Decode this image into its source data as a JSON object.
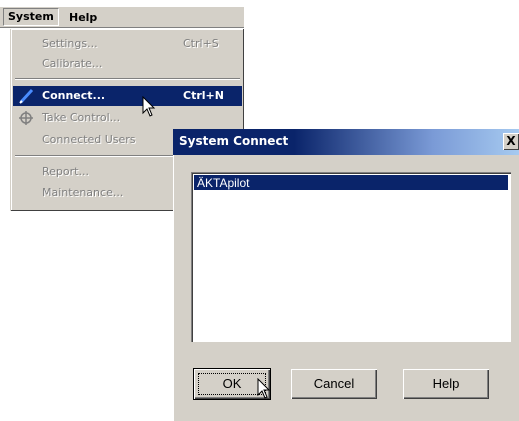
{
  "menubar": {
    "items": [
      {
        "label": "System",
        "active": true
      },
      {
        "label": "Help",
        "active": false
      }
    ]
  },
  "menu": {
    "items": [
      {
        "label": "Settings...",
        "shortcut": "Ctrl+S",
        "state": "disabled",
        "icon": ""
      },
      {
        "label": "Calibrate...",
        "shortcut": "",
        "state": "disabled",
        "icon": ""
      },
      {
        "label": "Connect...",
        "shortcut": "Ctrl+N",
        "state": "highlighted",
        "icon": "connect-pen-icon"
      },
      {
        "label": "Take Control...",
        "shortcut": "",
        "state": "disabled",
        "icon": "take-control-icon"
      },
      {
        "label": "Connected Users",
        "shortcut": "",
        "state": "disabled",
        "icon": ""
      },
      {
        "label": "Report...",
        "shortcut": "",
        "state": "disabled",
        "icon": ""
      },
      {
        "label": "Maintenance...",
        "shortcut": "",
        "state": "disabled",
        "icon": ""
      }
    ]
  },
  "dialog": {
    "title": "System Connect",
    "close_label": "X",
    "list_items": [
      {
        "label": "ÄKTApilot",
        "selected": true
      }
    ],
    "buttons": {
      "ok": "OK",
      "cancel": "Cancel",
      "help": "Help"
    }
  },
  "colors": {
    "selection": "#0a246a",
    "face": "#d4d0c8",
    "disabled_text": "#808080"
  }
}
